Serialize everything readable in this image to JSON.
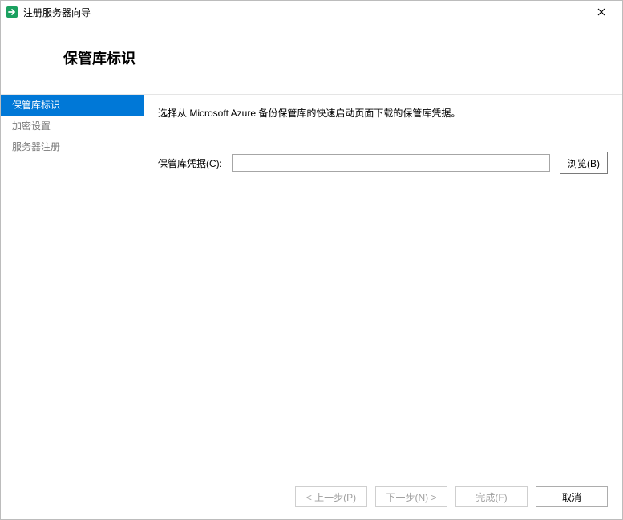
{
  "window": {
    "title": "注册服务器向导"
  },
  "header": {
    "title": "保管库标识"
  },
  "sidebar": {
    "items": [
      {
        "label": "保管库标识",
        "active": true
      },
      {
        "label": "加密设置",
        "active": false
      },
      {
        "label": "服务器注册",
        "active": false
      }
    ]
  },
  "content": {
    "instruction": "选择从 Microsoft Azure 备份保管库的快速启动页面下载的保管库凭据。",
    "credential_label": "保管库凭据(C):",
    "credential_value": "",
    "browse_label": "浏览(B)"
  },
  "footer": {
    "prev_label": "< 上一步(P)",
    "next_label": "下一步(N) >",
    "finish_label": "完成(F)",
    "cancel_label": "取消",
    "prev_enabled": false,
    "next_enabled": false,
    "finish_enabled": false,
    "cancel_enabled": true
  }
}
